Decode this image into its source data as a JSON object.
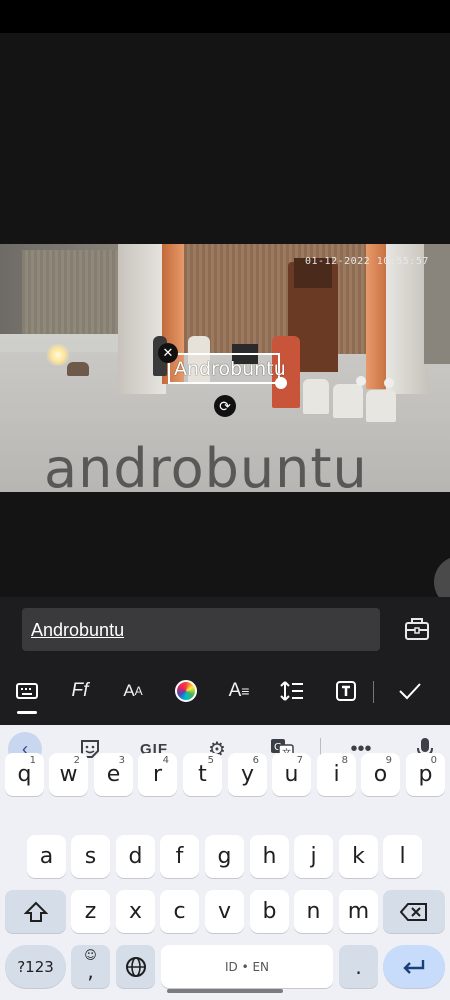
{
  "overlay": {
    "text": "Androbuntu",
    "timestamp": "01-12-2022 10:55:57",
    "watermark": "androbuntu"
  },
  "editor": {
    "text_value": "Androbuntu",
    "kit_icon": "toolbox-icon",
    "tools": [
      "keyboard-icon",
      "font-style-icon",
      "font-size-icon",
      "color-wheel-icon",
      "text-align-icon",
      "line-spacing-icon",
      "text-background-icon",
      "confirm-check-icon"
    ]
  },
  "keyboard": {
    "toolbar": [
      "back-icon",
      "sticker-icon",
      "GIF",
      "settings-icon",
      "translate-icon",
      "more-icon",
      "mic-icon"
    ],
    "gif_label": "GIF",
    "row1": [
      {
        "k": "q",
        "n": "1"
      },
      {
        "k": "w",
        "n": "2"
      },
      {
        "k": "e",
        "n": "3"
      },
      {
        "k": "r",
        "n": "4"
      },
      {
        "k": "t",
        "n": "5"
      },
      {
        "k": "y",
        "n": "6"
      },
      {
        "k": "u",
        "n": "7"
      },
      {
        "k": "i",
        "n": "8"
      },
      {
        "k": "o",
        "n": "9"
      },
      {
        "k": "p",
        "n": "0"
      }
    ],
    "row2": [
      "a",
      "s",
      "d",
      "f",
      "g",
      "h",
      "j",
      "k",
      "l"
    ],
    "row3": [
      "z",
      "x",
      "c",
      "v",
      "b",
      "n",
      "m"
    ],
    "symbols_label": "?123",
    "comma_label": ",",
    "space_label": "ID • EN",
    "period_label": "."
  }
}
